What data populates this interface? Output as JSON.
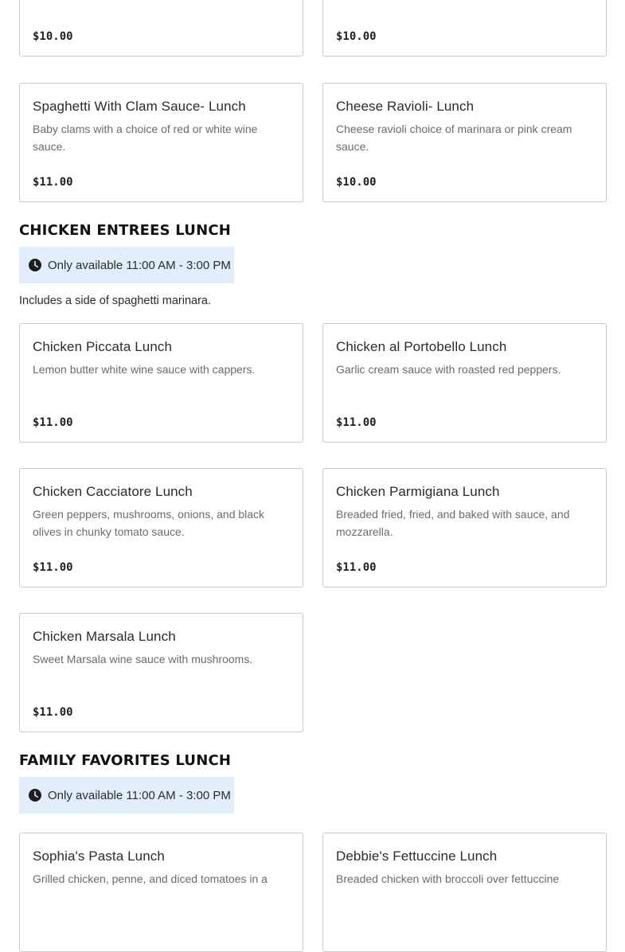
{
  "partial_cards": {
    "left_price": "$10.00",
    "right_price": "$10.00"
  },
  "pasta_cards": [
    {
      "name": "Spaghetti With Clam Sauce- Lunch",
      "description": "Baby clams with a choice of red or white wine sauce.",
      "price": "$11.00"
    },
    {
      "name": "Cheese Ravioli- Lunch",
      "description": "Cheese ravioli choice of marinara or pink cream sauce.",
      "price": "$10.00"
    }
  ],
  "chicken_section": {
    "title": "CHICKEN ENTREES LUNCH",
    "availability": "Only available 11:00 AM - 3:00 PM",
    "note": "Includes a side of spaghetti marinara.",
    "items": [
      {
        "name": "Chicken Piccata Lunch",
        "description": "Lemon butter white wine sauce with cappers.",
        "price": "$11.00"
      },
      {
        "name": "Chicken al Portobello Lunch",
        "description": "Garlic cream sauce with roasted red peppers.",
        "price": "$11.00"
      },
      {
        "name": "Chicken Cacciatore Lunch",
        "description": "Green peppers, mushrooms, onions, and black olives in chunky tomato sauce.",
        "price": "$11.00"
      },
      {
        "name": "Chicken Parmigiana Lunch",
        "description": "Breaded fried, fried, and baked with sauce, and mozzarella.",
        "price": "$11.00"
      },
      {
        "name": "Chicken Marsala Lunch",
        "description": "Sweet Marsala wine sauce with mushrooms.",
        "price": "$11.00"
      }
    ]
  },
  "family_section": {
    "title": "FAMILY FAVORITES LUNCH",
    "availability": "Only available 11:00 AM - 3:00 PM",
    "items": [
      {
        "name": "Sophia's Pasta Lunch",
        "description": "Grilled chicken, penne, and diced tomatoes in a"
      },
      {
        "name": "Debbie's Fettuccine Lunch",
        "description": "Breaded chicken with broccoli over fettuccine"
      }
    ]
  },
  "icons": {
    "clock": "clock-icon"
  },
  "colors": {
    "availability_bg": "#e2eefb",
    "card_border": "#c9c9c9",
    "description_text": "#6b6b6b"
  }
}
